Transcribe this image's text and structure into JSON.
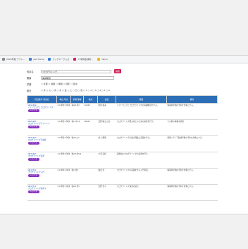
{
  "bookmarks": [
    {
      "label": "2025年度 アウト...",
      "color": "#888888"
    },
    {
      "label": "ps4 home",
      "color": "#3a7bd5"
    },
    {
      "label": "ブックマーク入力",
      "color": "#3a7bd5"
    },
    {
      "label": "Y! 時刻表検索...",
      "color": "#d81b60"
    },
    {
      "label": "Yahoo",
      "color": "#f4b400"
    }
  ],
  "form": {
    "subject_label": "科目名",
    "subject_value": "プログラミング",
    "search_button": "検索",
    "term_label": "開講",
    "term_value": "開講期間",
    "dept_label": "学期",
    "dept_options": "○ 全部 ○ 前期 ○ 後期 ○ 通年 ○ 集中",
    "campus_label": "曜日",
    "campus_options": "○ 月 ○ 火 ○ 水 ○ 木 ○ 金 ○ 土 ○ 日 ○ 他 ○ 1 ○ 2 ○ 3 ○ 4 ○ 5 ○ 6"
  },
  "table": {
    "headers": [
      "科目番号\n科目名",
      "単位\n年次",
      "学期\n曜時",
      "教室",
      "担当",
      "概要",
      "備考"
    ],
    "rows": [
      {
        "code": "GB11404",
        "name": "ソフトウェアとプログラミング",
        "credit": "2.0 単位 2年次",
        "term": "春AB 月2",
        "room": "3A203",
        "teacher": "阿部 和夫",
        "desc": "ソフトウェアとプログラミングの基礎概念を学ぶ。",
        "note": "情報科学類の学生を対象とする。",
        "pill": "シラバス"
      },
      {
        "code": "GB21601",
        "name": "プログラミングチャレンジ",
        "credit": "2.0 単位 2年次",
        "term": "春C 木3,4",
        "room": "3B203",
        "teacher": "天野 敏之 ほか",
        "desc": "プログラミング能力向上のための演習を行う。",
        "note": "その他の情報を参照",
        "pill": "シラバス"
      },
      {
        "code": "GB31404",
        "name": "プログラミング言語論",
        "credit": "2.0 単位 3年次",
        "term": "秋AB 火1",
        "room": "",
        "teacher": "井上 雅則",
        "desc": "プログラミング言語の理論と実装を学ぶ。",
        "note": "情報メディア創成学類の学生を対象とする。",
        "pill": "シラバス"
      },
      {
        "code": "GB31501",
        "name": "プログラミング演習",
        "credit": "2.0 単位 3年次",
        "term": "秋AB 水5,6",
        "room": "",
        "teacher": "大澤 英紀",
        "desc": "実践的なプログラミングの演習を行う。",
        "note": "",
        "pill": "シラバス"
      },
      {
        "code": "GB12701",
        "name": "プログラミング入門",
        "credit": "2.0 単位 1年次",
        "term": "秋C 金2",
        "room": "",
        "teacher": "亀田 浩",
        "desc": "プログラミングの基礎を学ぶ入門科目。",
        "note": "情報科学類の学生を対象とする。",
        "pill": "シラバス"
      },
      {
        "code": "GB12712",
        "name": "プログラミング演習 II",
        "credit": "2.0 単位 1年次",
        "term": "秋AB 月5",
        "room": "",
        "teacher": "天野 史人",
        "desc": "プログラミング演習の続き。",
        "note": "情報科学類の学生を対象とする。",
        "pill": "シラバス"
      }
    ]
  }
}
